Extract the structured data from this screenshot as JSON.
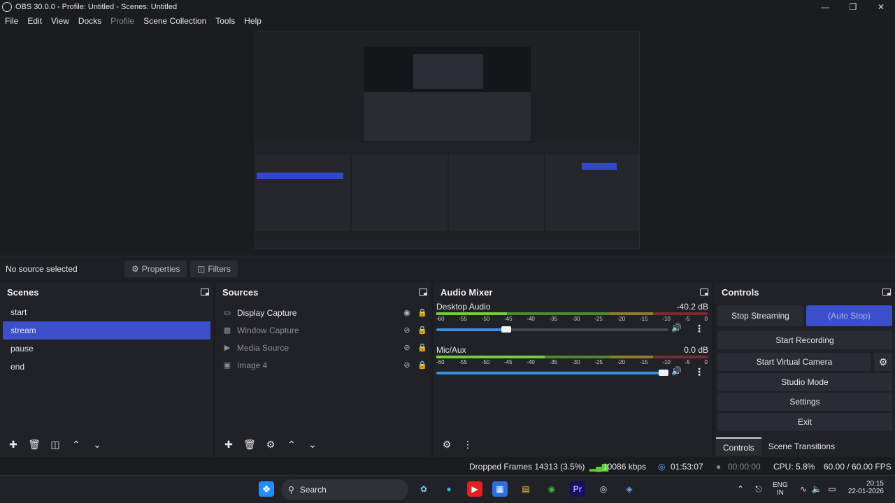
{
  "window": {
    "title": "OBS 30.0.0 - Profile: Untitled - Scenes: Untitled"
  },
  "menu": [
    "File",
    "Edit",
    "View",
    "Docks",
    "Profile",
    "Scene Collection",
    "Tools",
    "Help"
  ],
  "props_bar": {
    "no_source": "No source selected",
    "properties": "Properties",
    "filters": "Filters"
  },
  "scenes": {
    "title": "Scenes",
    "items": [
      "start",
      "stream",
      "pause",
      "end"
    ],
    "selected": "stream"
  },
  "sources": {
    "title": "Sources",
    "items": [
      {
        "name": "Display Capture",
        "icon": "monitor-icon",
        "visible": true
      },
      {
        "name": "Window Capture",
        "icon": "window-icon",
        "visible": false
      },
      {
        "name": "Media Source",
        "icon": "play-icon",
        "visible": false
      },
      {
        "name": "Image 4",
        "icon": "image-icon",
        "visible": false
      }
    ]
  },
  "mixer": {
    "title": "Audio Mixer",
    "channels": [
      {
        "name": "Desktop Audio",
        "db": "-40.2 dB",
        "level": 0.26,
        "volume": 0.3
      },
      {
        "name": "Mic/Aux",
        "db": "0.0 dB",
        "level": 0.4,
        "volume": 0.98
      }
    ],
    "ticks": [
      "-60",
      "-55",
      "-50",
      "-45",
      "-40",
      "-35",
      "-30",
      "-25",
      "-20",
      "-15",
      "-10",
      "-5",
      "0"
    ]
  },
  "controls": {
    "title": "Controls",
    "stop_streaming": "Stop Streaming",
    "auto_stop": "(Auto Stop)",
    "start_recording": "Start Recording",
    "start_virtual_camera": "Start Virtual Camera",
    "studio_mode": "Studio Mode",
    "settings": "Settings",
    "exit": "Exit",
    "tab_controls": "Controls",
    "tab_transitions": "Scene Transitions"
  },
  "status": {
    "dropped": "Dropped Frames 14313 (3.5%)",
    "kbps": "10086 kbps",
    "stream_time": "01:53:07",
    "rec_time": "00:00:00",
    "cpu": "CPU: 5.8%",
    "fps": "60.00 / 60.00 FPS"
  },
  "taskbar": {
    "search": "Search",
    "lang": "ENG",
    "region": "IN",
    "time": "20:15",
    "date": "22-01-2026"
  },
  "colors": {
    "accent": "#3a4fc9",
    "meter_green": "#6fcf3e",
    "volume_blue": "#3b8fe0"
  }
}
